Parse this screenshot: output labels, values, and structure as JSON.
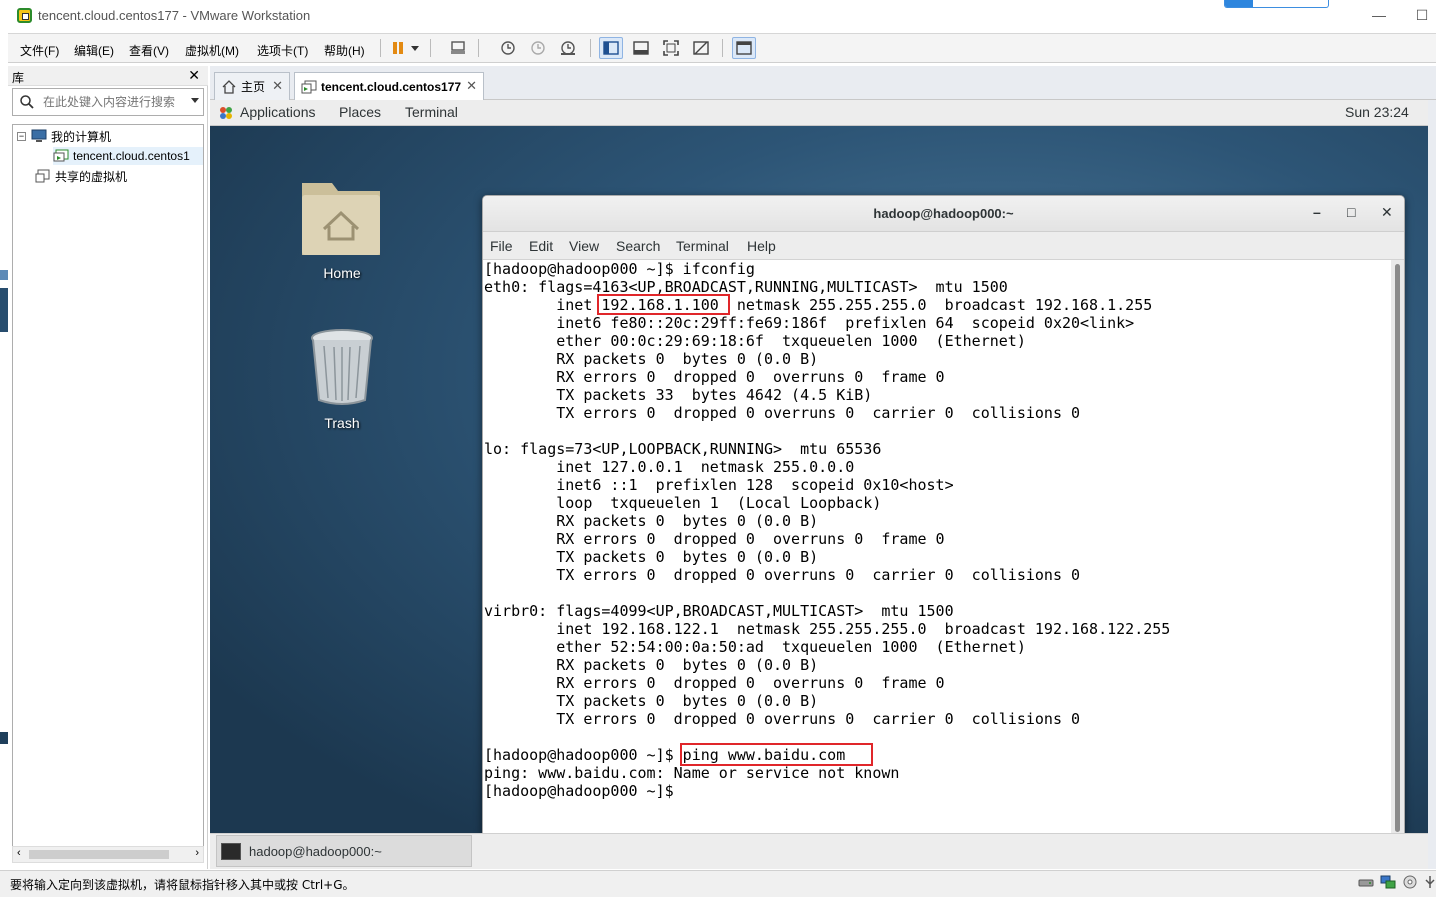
{
  "window": {
    "title": "tencent.cloud.centos177 - VMware Workstation",
    "minimize": "—",
    "maximize": "☐"
  },
  "menubar": {
    "items": [
      "文件(F)",
      "编辑(E)",
      "查看(V)",
      "虚拟机(M)",
      "选项卡(T)",
      "帮助(H)"
    ]
  },
  "library": {
    "title": "库",
    "close": "✕",
    "search_placeholder": "在此处键入内容进行搜索",
    "tree": {
      "my_computer": "我的计算机",
      "vm_item": "tencent.cloud.centos1",
      "shared": "共享的虚拟机",
      "collapse_glyph": "−"
    }
  },
  "tabs": [
    {
      "label": "主页",
      "close": "✕"
    },
    {
      "label": "tencent.cloud.centos177",
      "close": "✕"
    }
  ],
  "guest": {
    "topbar": {
      "applications": "Applications",
      "places": "Places",
      "terminal": "Terminal",
      "clock": "Sun 23:24"
    },
    "desktop_icons": {
      "home": "Home",
      "trash": "Trash"
    },
    "terminal": {
      "title": "hadoop@hadoop000:~",
      "controls": {
        "min": "–",
        "max": "□",
        "close": "✕"
      },
      "menu": [
        "File",
        "Edit",
        "View",
        "Search",
        "Terminal",
        "Help"
      ],
      "lines": [
        "[hadoop@hadoop000 ~]$ ifconfig",
        "eth0: flags=4163<UP,BROADCAST,RUNNING,MULTICAST>  mtu 1500",
        "        inet 192.168.1.100  netmask 255.255.255.0  broadcast 192.168.1.255",
        "        inet6 fe80::20c:29ff:fe69:186f  prefixlen 64  scopeid 0x20<link>",
        "        ether 00:0c:29:69:18:6f  txqueuelen 1000  (Ethernet)",
        "        RX packets 0  bytes 0 (0.0 B)",
        "        RX errors 0  dropped 0  overruns 0  frame 0",
        "        TX packets 33  bytes 4642 (4.5 KiB)",
        "        TX errors 0  dropped 0 overruns 0  carrier 0  collisions 0",
        "",
        "lo: flags=73<UP,LOOPBACK,RUNNING>  mtu 65536",
        "        inet 127.0.0.1  netmask 255.0.0.0",
        "        inet6 ::1  prefixlen 128  scopeid 0x10<host>",
        "        loop  txqueuelen 1  (Local Loopback)",
        "        RX packets 0  bytes 0 (0.0 B)",
        "        RX errors 0  dropped 0  overruns 0  frame 0",
        "        TX packets 0  bytes 0 (0.0 B)",
        "        TX errors 0  dropped 0 overruns 0  carrier 0  collisions 0",
        "",
        "virbr0: flags=4099<UP,BROADCAST,MULTICAST>  mtu 1500",
        "        inet 192.168.122.1  netmask 255.255.255.0  broadcast 192.168.122.255",
        "        ether 52:54:00:0a:50:ad  txqueuelen 1000  (Ethernet)",
        "        RX packets 0  bytes 0 (0.0 B)",
        "        RX errors 0  dropped 0  overruns 0  frame 0",
        "        TX packets 0  bytes 0 (0.0 B)",
        "        TX errors 0  dropped 0 overruns 0  carrier 0  collisions 0",
        "",
        "[hadoop@hadoop000 ~]$ ping www.baidu.com",
        "ping: www.baidu.com: Name or service not known",
        "[hadoop@hadoop000 ~]$"
      ],
      "highlight_color": "#e0262a"
    },
    "taskbar": {
      "item": "hadoop@hadoop000:~"
    }
  },
  "statusbar": {
    "text": "要将输入定向到该虚拟机，请将鼠标指针移入其中或按 Ctrl+G。"
  }
}
